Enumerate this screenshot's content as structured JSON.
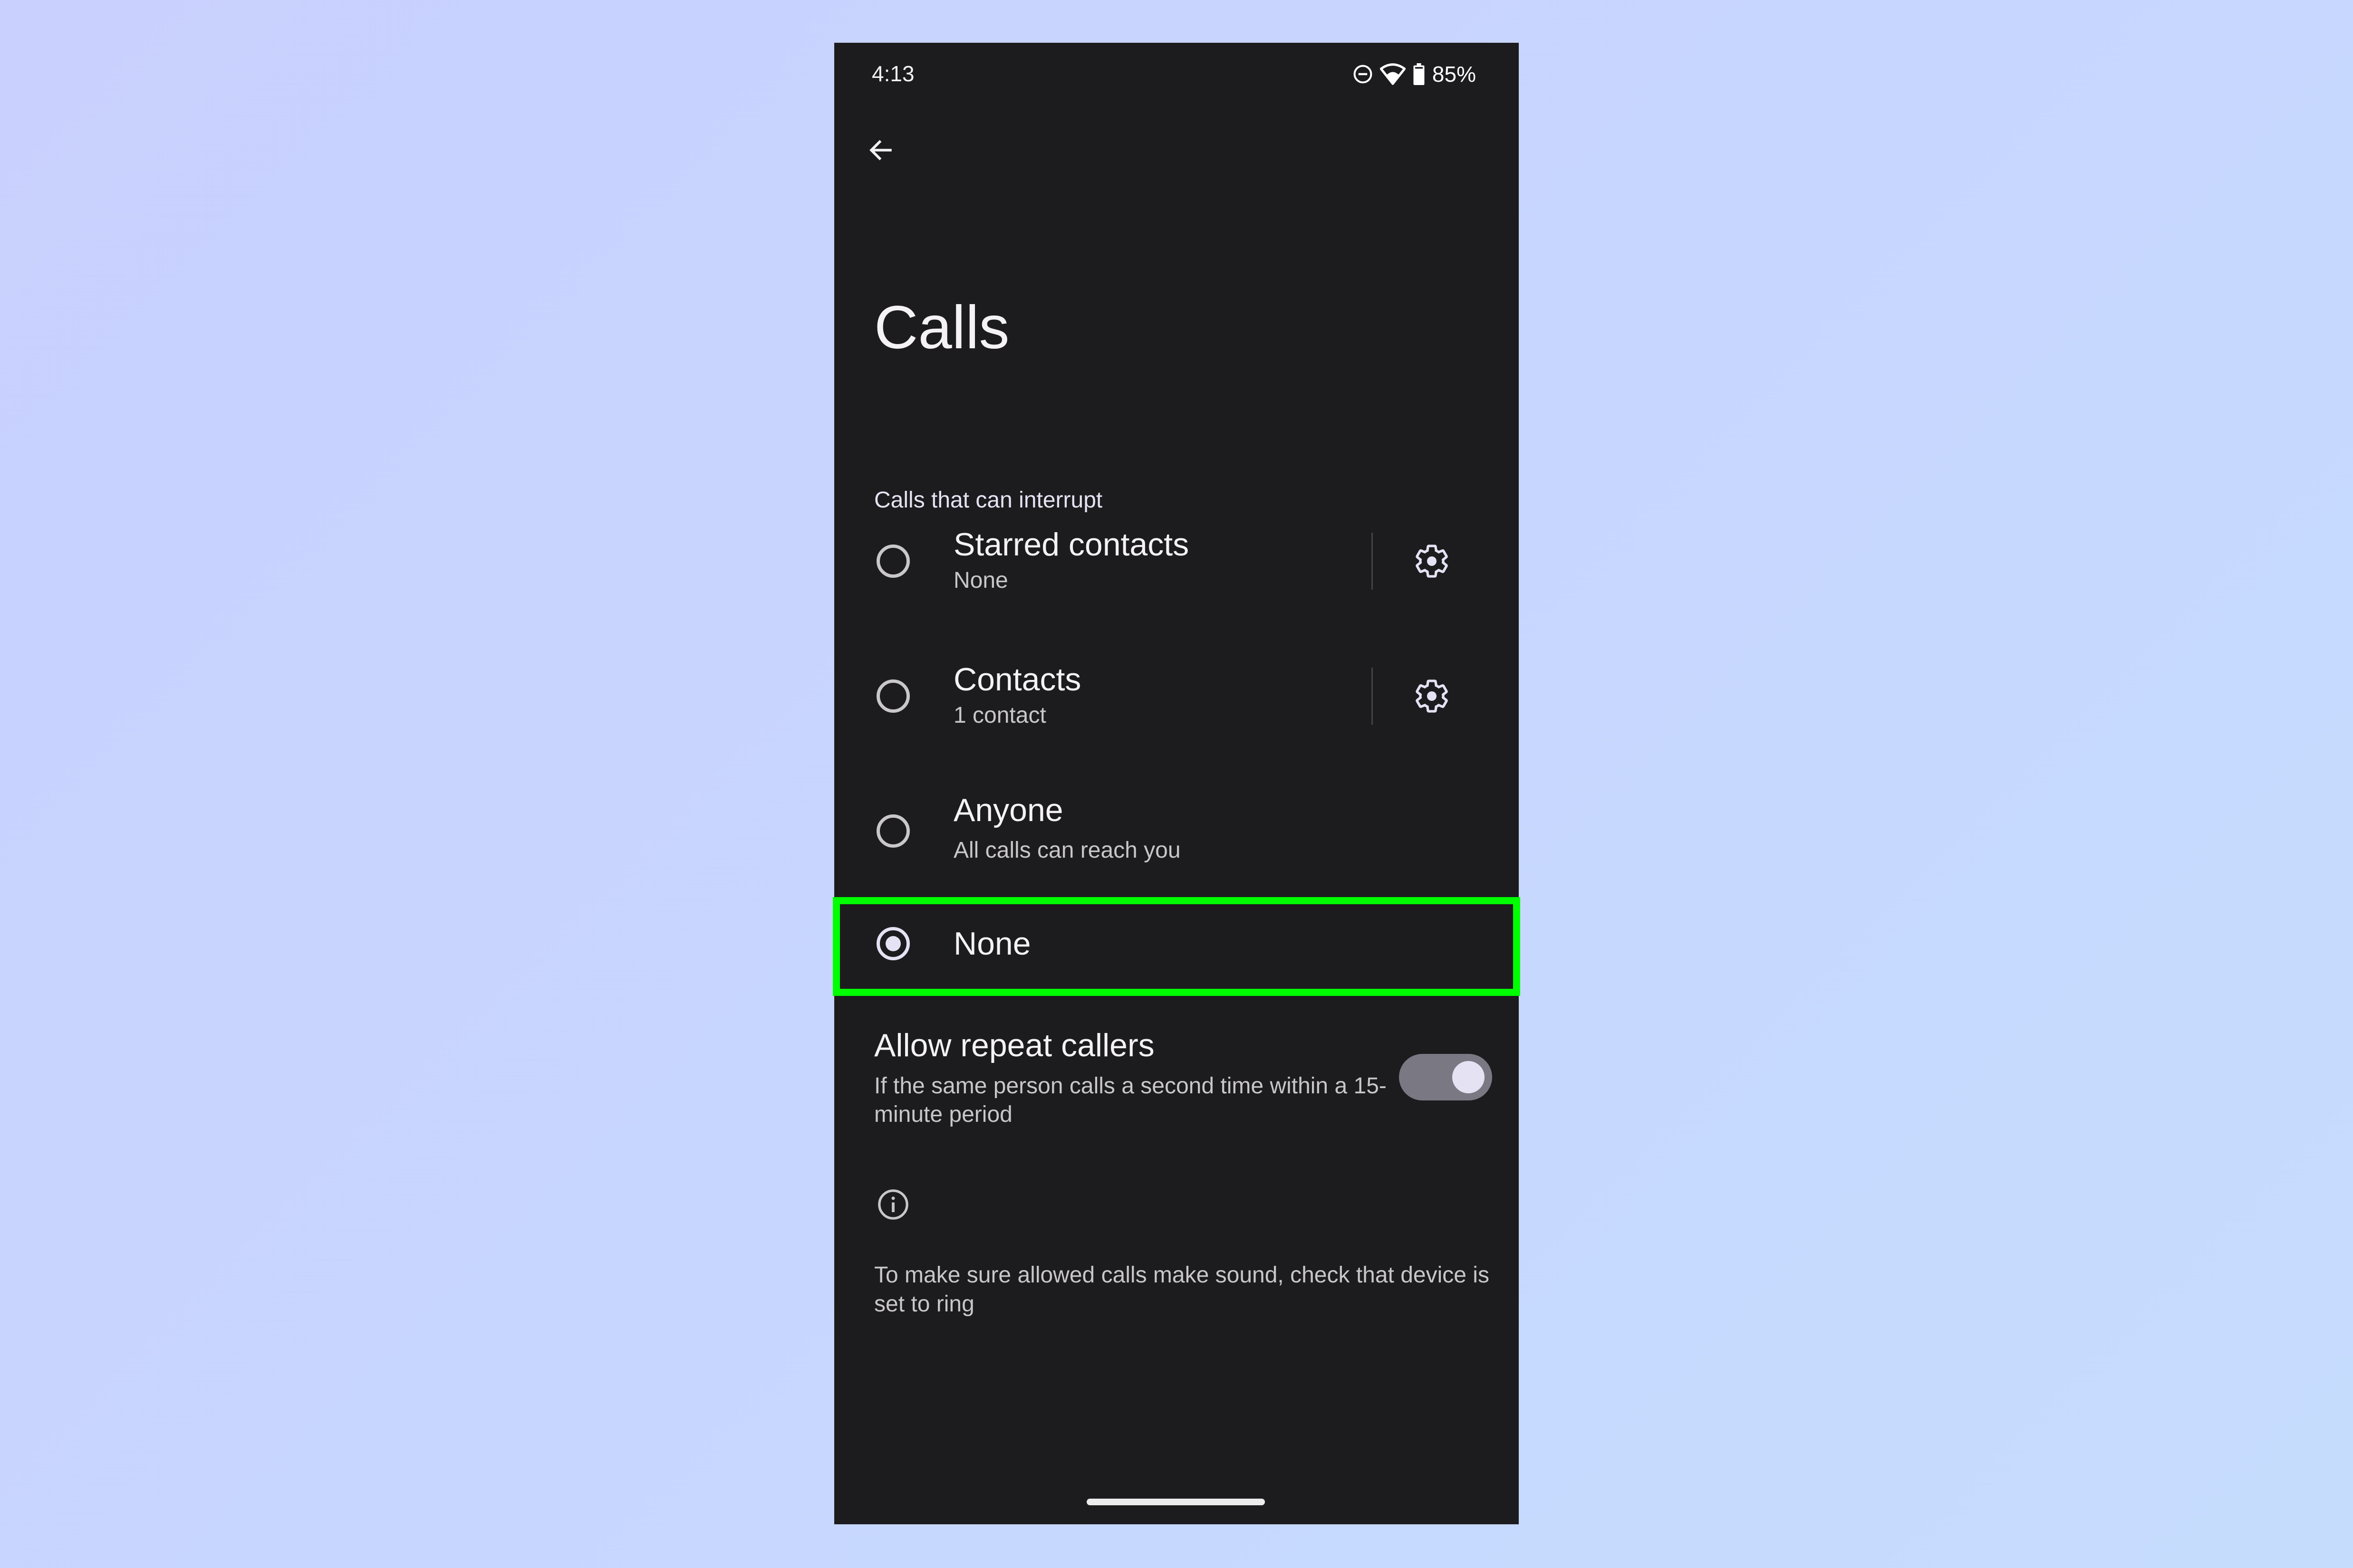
{
  "status_bar": {
    "time": "4:13",
    "icons": [
      "do-not-disturb-icon",
      "wifi-icon",
      "battery-icon"
    ],
    "battery_percent": "85%"
  },
  "header": {
    "back_icon": "arrow-left-icon",
    "title": "Calls"
  },
  "section": {
    "label": "Calls that can interrupt"
  },
  "options": [
    {
      "title": "Starred contacts",
      "subtitle": "None",
      "selected": false,
      "has_settings": true
    },
    {
      "title": "Contacts",
      "subtitle": "1 contact",
      "selected": false,
      "has_settings": true
    },
    {
      "title": "Anyone",
      "subtitle": "All calls can reach you",
      "selected": false,
      "has_settings": false
    },
    {
      "title": "None",
      "subtitle": "",
      "selected": true,
      "has_settings": false
    }
  ],
  "repeat_callers": {
    "title": "Allow repeat callers",
    "description": "If the same person calls a second time within a 15-minute period",
    "enabled": true
  },
  "info": {
    "icon": "info-icon",
    "text": "To make sure allowed calls make sound, check that device is set to ring"
  },
  "colors": {
    "highlight": "#00ff00",
    "surface": "#1c1c1e",
    "accent": "#e4e2f3"
  }
}
